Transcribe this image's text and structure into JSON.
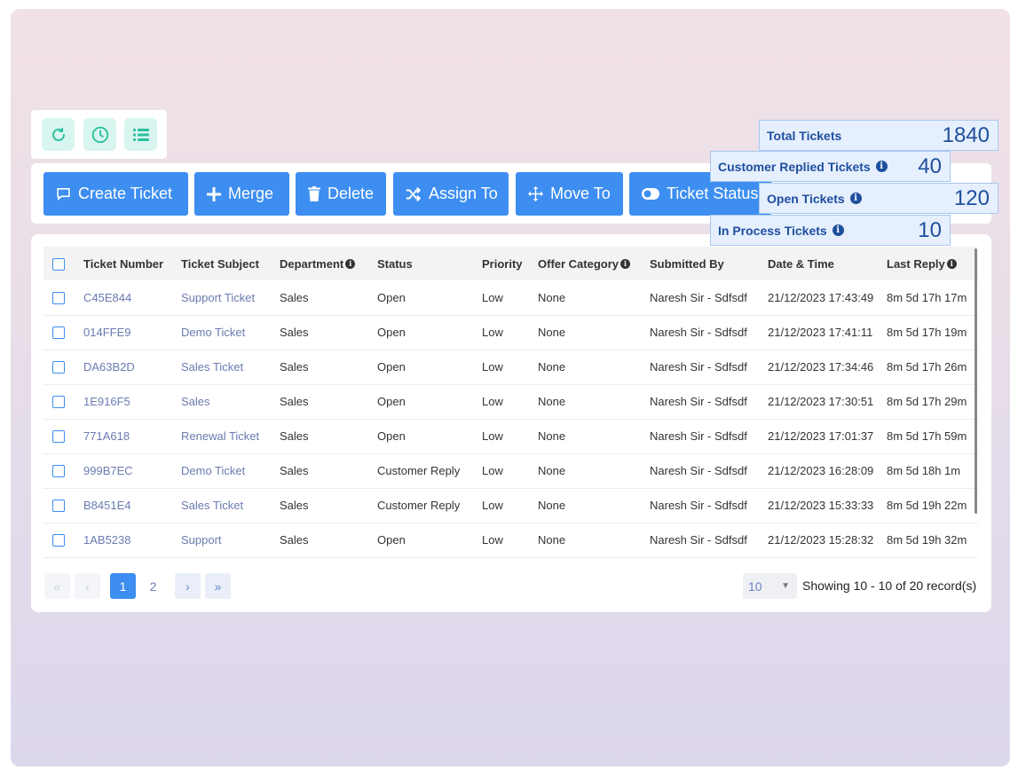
{
  "toolbar_icons": [
    {
      "icon": "refresh-icon"
    },
    {
      "icon": "history-clock-icon"
    },
    {
      "icon": "list-icon"
    }
  ],
  "actions": {
    "create": "Create Ticket",
    "merge": "Merge",
    "delete": "Delete",
    "assign": "Assign To",
    "move": "Move To",
    "status": "Ticket Status"
  },
  "stats": {
    "total": {
      "label": "Total Tickets",
      "value": "1840"
    },
    "replied": {
      "label": "Customer Replied Tickets",
      "value": "40"
    },
    "open": {
      "label": "Open Tickets",
      "value": "120"
    },
    "in_process": {
      "label": "In Process Tickets",
      "value": "10"
    }
  },
  "table": {
    "columns": {
      "number": "Ticket Number",
      "subject": "Ticket Subject",
      "department": "Department",
      "status": "Status",
      "priority": "Priority",
      "offer": "Offer Category",
      "submitted": "Submitted By",
      "datetime": "Date & Time",
      "last_reply": "Last Reply"
    },
    "rows": [
      {
        "number": "C45E844",
        "subject": "Support Ticket",
        "department": "Sales",
        "status": "Open",
        "priority": "Low",
        "offer": "None",
        "submitted": "Naresh Sir - Sdfsdf",
        "datetime": "21/12/2023 17:43:49",
        "last_reply": "8m 5d 17h 17m"
      },
      {
        "number": "014FFE9",
        "subject": "Demo Ticket",
        "department": "Sales",
        "status": "Open",
        "priority": "Low",
        "offer": "None",
        "submitted": "Naresh Sir - Sdfsdf",
        "datetime": "21/12/2023 17:41:11",
        "last_reply": "8m 5d 17h 19m"
      },
      {
        "number": "DA63B2D",
        "subject": "Sales Ticket",
        "department": "Sales",
        "status": "Open",
        "priority": "Low",
        "offer": "None",
        "submitted": "Naresh Sir - Sdfsdf",
        "datetime": "21/12/2023 17:34:46",
        "last_reply": "8m 5d 17h 26m"
      },
      {
        "number": "1E916F5",
        "subject": "Sales",
        "department": "Sales",
        "status": "Open",
        "priority": "Low",
        "offer": "None",
        "submitted": "Naresh Sir - Sdfsdf",
        "datetime": "21/12/2023 17:30:51",
        "last_reply": "8m 5d 17h 29m"
      },
      {
        "number": "771A618",
        "subject": "Renewal Ticket",
        "department": "Sales",
        "status": "Open",
        "priority": "Low",
        "offer": "None",
        "submitted": "Naresh Sir - Sdfsdf",
        "datetime": "21/12/2023 17:01:37",
        "last_reply": "8m 5d 17h 59m"
      },
      {
        "number": "999B7EC",
        "subject": "Demo Ticket",
        "department": "Sales",
        "status": "Customer Reply",
        "priority": "Low",
        "offer": "None",
        "submitted": "Naresh Sir - Sdfsdf",
        "datetime": "21/12/2023 16:28:09",
        "last_reply": "8m 5d 18h 1m"
      },
      {
        "number": "B8451E4",
        "subject": "Sales Ticket",
        "department": "Sales",
        "status": "Customer Reply",
        "priority": "Low",
        "offer": "None",
        "submitted": "Naresh Sir - Sdfsdf",
        "datetime": "21/12/2023 15:33:33",
        "last_reply": "8m 5d 19h 22m"
      },
      {
        "number": "1AB5238",
        "subject": "Support",
        "department": "Sales",
        "status": "Open",
        "priority": "Low",
        "offer": "None",
        "submitted": "Naresh Sir - Sdfsdf",
        "datetime": "21/12/2023 15:28:32",
        "last_reply": "8m 5d 19h 32m"
      }
    ]
  },
  "pagination": {
    "first": "«",
    "prev": "‹",
    "pages": [
      "1",
      "2"
    ],
    "current": "1",
    "next": "›",
    "last": "»",
    "per_page": "10",
    "showing": "Showing 10 - 10 of 20 record(s)"
  },
  "colors": {
    "primary": "#3d8ef0",
    "stat_text": "#1d4f9e",
    "icon_teal": "#2bbf9c",
    "link": "#6a7bb0"
  }
}
